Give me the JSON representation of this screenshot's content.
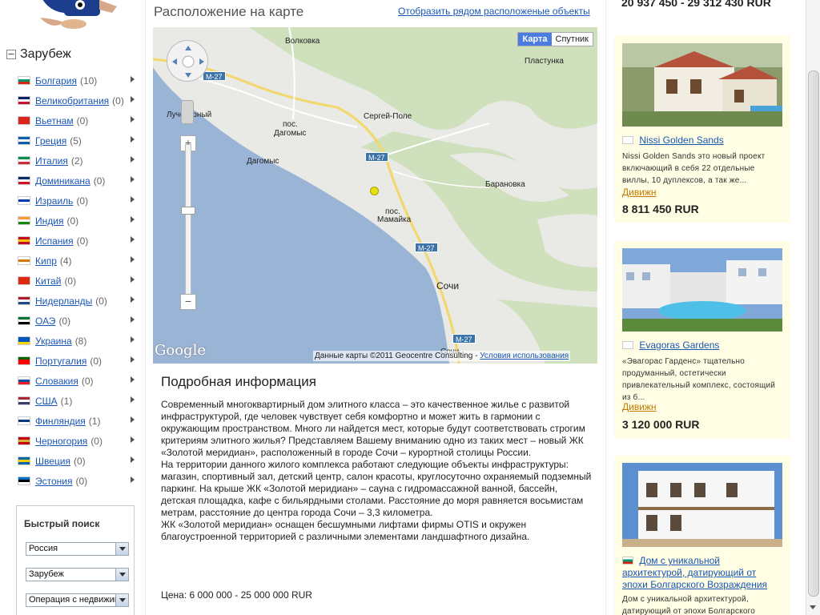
{
  "sidebar": {
    "section_title": "Зарубеж",
    "toggle_symbol": "−",
    "countries": [
      {
        "name": "Болгария",
        "count": "(10)",
        "flag": [
          "#ffffff",
          "#00966e",
          "#d62612"
        ]
      },
      {
        "name": "Великобритания",
        "count": "(0)",
        "flag": [
          "#012169",
          "#ffffff",
          "#c8102e"
        ]
      },
      {
        "name": "Вьетнам",
        "count": "(0)",
        "flag": [
          "#da251d",
          "#da251d",
          "#da251d"
        ]
      },
      {
        "name": "Греция",
        "count": "(5)",
        "flag": [
          "#0d5eaf",
          "#ffffff",
          "#0d5eaf"
        ]
      },
      {
        "name": "Италия",
        "count": "(2)",
        "flag": [
          "#009246",
          "#ffffff",
          "#ce2b37"
        ]
      },
      {
        "name": "Доминикана",
        "count": "(0)",
        "flag": [
          "#002d62",
          "#ffffff",
          "#ce1126"
        ]
      },
      {
        "name": "Израиль",
        "count": "(0)",
        "flag": [
          "#ffffff",
          "#0038b8",
          "#ffffff"
        ]
      },
      {
        "name": "Индия",
        "count": "(0)",
        "flag": [
          "#ff9933",
          "#ffffff",
          "#138808"
        ]
      },
      {
        "name": "Испания",
        "count": "(0)",
        "flag": [
          "#c60b1e",
          "#ffc400",
          "#c60b1e"
        ]
      },
      {
        "name": "Кипр",
        "count": "(4)",
        "flag": [
          "#ffffff",
          "#d57800",
          "#ffffff"
        ]
      },
      {
        "name": "Китай",
        "count": "(0)",
        "flag": [
          "#de2910",
          "#de2910",
          "#de2910"
        ]
      },
      {
        "name": "Нидерланды",
        "count": "(0)",
        "flag": [
          "#ae1c28",
          "#ffffff",
          "#21468b"
        ]
      },
      {
        "name": "ОАЭ",
        "count": "(0)",
        "flag": [
          "#00732f",
          "#ffffff",
          "#000000"
        ]
      },
      {
        "name": "Украина",
        "count": "(8)",
        "flag": [
          "#0057b7",
          "#0057b7",
          "#ffd700"
        ]
      },
      {
        "name": "Португалия",
        "count": "(0)",
        "flag": [
          "#006600",
          "#ff0000",
          "#ff0000"
        ]
      },
      {
        "name": "Словакия",
        "count": "(0)",
        "flag": [
          "#ffffff",
          "#0b4ea2",
          "#ee1c25"
        ]
      },
      {
        "name": "США",
        "count": "(1)",
        "flag": [
          "#b22234",
          "#ffffff",
          "#3c3b6e"
        ]
      },
      {
        "name": "Финляндия",
        "count": "(1)",
        "flag": [
          "#ffffff",
          "#003580",
          "#ffffff"
        ]
      },
      {
        "name": "Черногория",
        "count": "(0)",
        "flag": [
          "#c40308",
          "#d4af37",
          "#c40308"
        ]
      },
      {
        "name": "Швеция",
        "count": "(0)",
        "flag": [
          "#006aa7",
          "#fecc00",
          "#006aa7"
        ]
      },
      {
        "name": "Эстония",
        "count": "(0)",
        "flag": [
          "#0072ce",
          "#000000",
          "#ffffff"
        ]
      }
    ],
    "quick_search": {
      "title": "Быстрый поиск",
      "country_select": "Россия",
      "region_select": "Зарубеж",
      "operation_select": "Операция с недвижимостью"
    }
  },
  "map_section": {
    "title": "Расположение на карте",
    "show_nearby_link": "Отобразить рядом расположеные объекты",
    "map_type": {
      "map": "Карта",
      "satellite": "Спутник"
    },
    "zoom_in": "+",
    "zoom_out": "−",
    "google_logo": "Google",
    "credits": "Данные карты ©2011 Geocentre Consulting -",
    "terms_link": "Условия использования",
    "labels": {
      "volkovka": "Волковка",
      "plastunka": "Пластунка",
      "luch": "Лучезарный",
      "dagomys_pos": "пос.",
      "dagomys_pos2": "Дагомыс",
      "sergey_pole": "Сергей-Поле",
      "dagomys": "Дагомыс",
      "baranovka": "Барановка",
      "mamayka_pos": "пос.",
      "mamayka": "Мамайка",
      "sochi": "Сочи",
      "sochi_bottom": "Сочи"
    },
    "roads": {
      "m27_a": "M-27",
      "m27_b": "M-27",
      "m27_c": "M-27",
      "m27_d": "M-27"
    }
  },
  "details": {
    "title": "Подробная информация",
    "paragraphs": [
      "Современный многоквартирный дом элитного класса – это качественное жилье с развитой инфраструктурой, где человек чувствует себя комфортно и может жить в гармонии с окружающим пространством. Много ли найдется мест, которые будут соответствовать строгим критериям элитного жилья? Представляем Вашему вниманию одно из таких мест – новый ЖК «Золотой меридиан», расположенный в городе Сочи – курортной столицы России.",
      "На территории данного жилого комплекса работают следующие объекты инфраструктуры: магазин, спортивный зал, детский центр, салон красоты, круглосуточно охраняемый подземный паркинг. На крыше ЖК «Золотой меридиан» – сауна с гидромассажной ванной, бассейн, детская площадка, кафе с бильярдными столами. Расстояние до моря равняется восьмистам метрам, расстояние до центра города Сочи – 3,3 километра.",
      "ЖК «Золотой меридиан» оснащен бесшумными лифтами фирмы OTIS и окружен благоустроенной территорией с различными элементами ландшафтного дизайна."
    ],
    "price": "Цена: 6 000 000 - 25 000 000 RUR"
  },
  "right": {
    "top_price": "20 937 450 - 29 312 430 RUR",
    "cards": [
      {
        "title": "Nissi Golden Sands",
        "flag": "#d57800",
        "desc": "Nissi Golden Sands это новый проект включающий в себя 22 отдельные виллы, 10 дуплексов, а так же...",
        "location": "Дивижн",
        "price": "8 811 450 RUR"
      },
      {
        "title": "Evagoras Gardens",
        "flag": "#d57800",
        "desc": "«Эвагорас Гарденс» тщательно продуманный, остетически привлекательный комплекс, состоящий из б...",
        "location": "Дивижн",
        "price": "3 120 000 RUR"
      },
      {
        "title": "Дом с уникальной архитектурой, датирующий от эпохи Болгарского Возраждения",
        "flag": "#00966e",
        "desc": "Дом с уникальной архитектурой, датирующий от эпохи Болгарского",
        "location": "",
        "price": ""
      }
    ]
  }
}
